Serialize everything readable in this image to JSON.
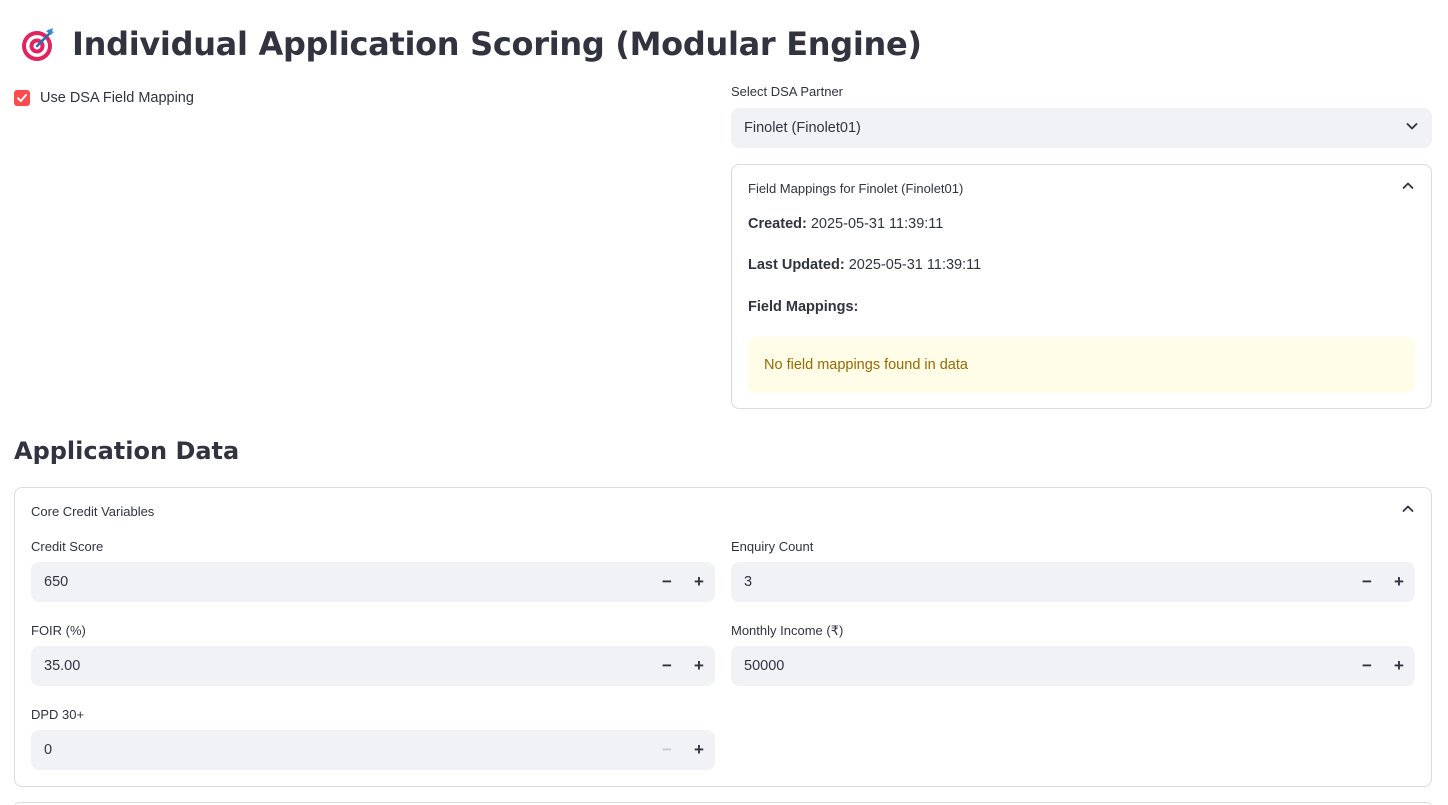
{
  "page": {
    "title": "Individual Application Scoring (Modular Engine)",
    "title_icon": "target-dart-icon"
  },
  "dsa": {
    "checkbox_label": "Use DSA Field Mapping",
    "checkbox_checked": true,
    "select_label": "Select DSA Partner",
    "select_value": "Finolet (Finolet01)"
  },
  "mapping_expander": {
    "title": "Field Mappings for Finolet (Finolet01)",
    "created_label": "Created:",
    "created_value": "2025-05-31 11:39:11",
    "updated_label": "Last Updated:",
    "updated_value": "2025-05-31 11:39:11",
    "mappings_heading": "Field Mappings:",
    "warning": "No field mappings found in data"
  },
  "application": {
    "heading": "Application Data",
    "core_expander_title": "Core Credit Variables",
    "fields": [
      {
        "label": "Credit Score",
        "value": "650",
        "minus_disabled": false
      },
      {
        "label": "Enquiry Count",
        "value": "3",
        "minus_disabled": false
      },
      {
        "label": "FOIR (%)",
        "value": "35.00",
        "minus_disabled": false
      },
      {
        "label": "Monthly Income (₹)",
        "value": "50000",
        "minus_disabled": false
      },
      {
        "label": "DPD 30+",
        "value": "0",
        "minus_disabled": true
      }
    ],
    "minus_symbol": "−",
    "plus_symbol": "+"
  },
  "colors": {
    "accent": "#ff4b4b",
    "input_bg": "#f0f2f6",
    "warning_bg": "#fffce7",
    "warning_text": "#926c05"
  }
}
